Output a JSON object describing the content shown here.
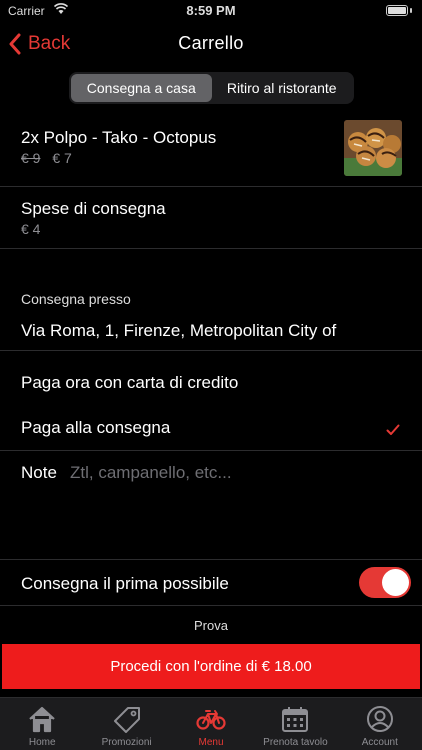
{
  "status_bar": {
    "carrier": "Carrier",
    "time": "8:59 PM"
  },
  "nav": {
    "back_label": "Back",
    "title": "Carrello"
  },
  "segments": [
    {
      "label": "Consegna a casa",
      "active": true
    },
    {
      "label": "Ritiro al ristorante",
      "active": false
    }
  ],
  "cart_item": {
    "name": "2x Polpo - Tako - Octopus",
    "old_price": "€ 9",
    "price": "€ 7"
  },
  "delivery_fee": {
    "label": "Spese di consegna",
    "price": "€ 4"
  },
  "address": {
    "label": "Consegna presso",
    "value": "Via Roma, 1, Firenze, Metropolitan City of"
  },
  "payment": {
    "options": [
      {
        "label": "Paga ora con carta di credito",
        "selected": false
      },
      {
        "label": "Paga alla consegna",
        "selected": true
      }
    ]
  },
  "note": {
    "label": "Note",
    "placeholder": "Ztl, campanello, etc..."
  },
  "asap": {
    "label": "Consegna il prima possibile",
    "enabled": true
  },
  "footer_text": "Prova",
  "order_button": "Procedi con l'ordine di € 18.00",
  "tabs": [
    {
      "label": "Home",
      "icon": "home-icon",
      "active": false
    },
    {
      "label": "Promozioni",
      "icon": "tag-icon",
      "active": false
    },
    {
      "label": "Menu",
      "icon": "bicycle-icon",
      "active": true
    },
    {
      "label": "Prenota tavolo",
      "icon": "calendar-icon",
      "active": false
    },
    {
      "label": "Account",
      "icon": "account-icon",
      "active": false
    }
  ],
  "colors": {
    "accent": "#e53935",
    "order_button": "#ee1c1c",
    "background": "#000000",
    "segment_active": "#636366"
  }
}
